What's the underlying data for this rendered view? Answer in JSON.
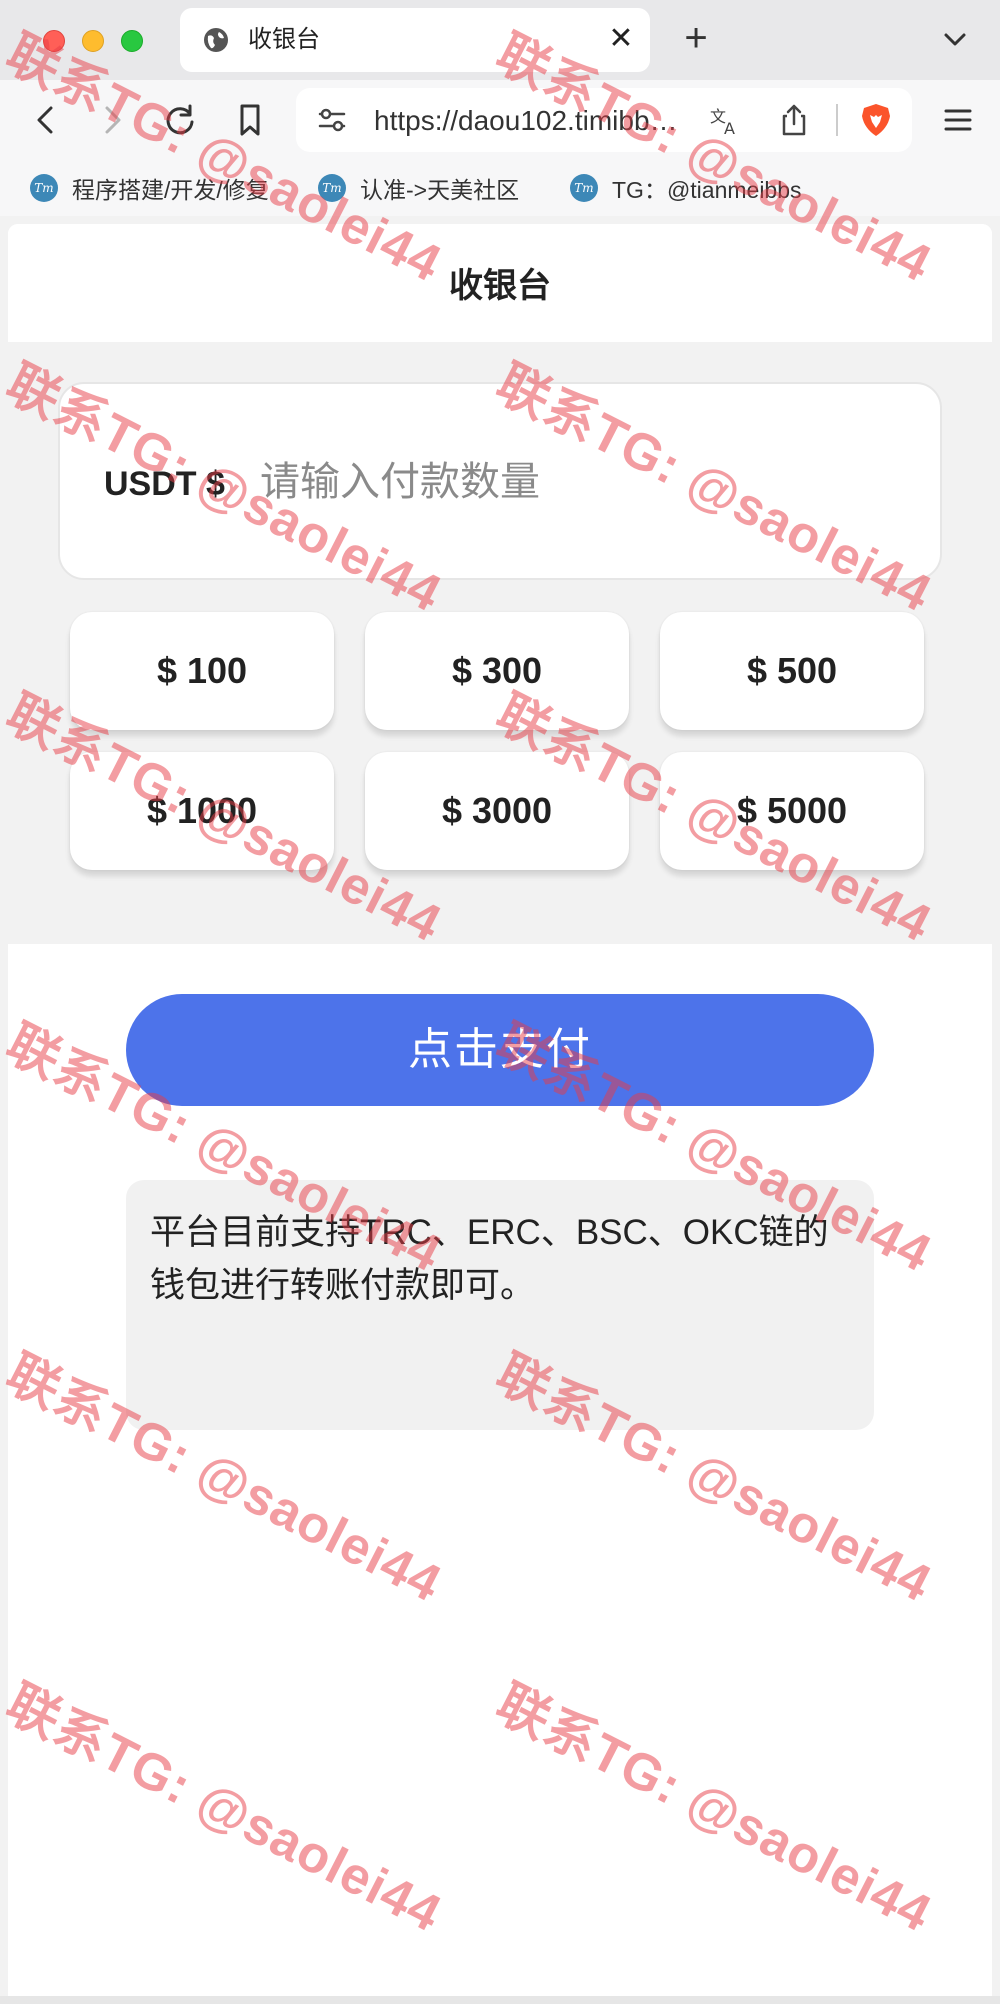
{
  "browser": {
    "tab_title": "收银台",
    "tab_close_glyph": "✕",
    "new_tab_glyph": "+",
    "url": "https://daou102.timibbs.com",
    "bookmarks": [
      {
        "label": "程序搭建/开发/修复",
        "icon": "tm-logo-icon"
      },
      {
        "label": "认准->天美社区",
        "icon": "tm-logo-icon"
      },
      {
        "label": "TG：@tianmeibbs",
        "icon": "tm-logo-icon"
      }
    ],
    "bookmark_logo_text": "Tm",
    "colors": {
      "tabbar": "#e8e8ea",
      "toolbar": "#f7f7f8",
      "brave_orange": "#fb542b"
    }
  },
  "page": {
    "title": "收银台",
    "currency_label": "USDT $",
    "amount_placeholder": "请输入付款数量",
    "presets": [
      "$ 100",
      "$ 300",
      "$ 500",
      "$ 1000",
      "$ 3000",
      "$ 5000"
    ],
    "pay_button_label": "点击支付",
    "notice": "平台目前支持TRC、ERC、BSC、OKC链的钱包进行转账付款即可。",
    "colors": {
      "accent": "#4d73ea",
      "section_bg": "#f2f2f2",
      "notice_bg": "#f1f1f1"
    }
  },
  "watermark": {
    "text": "联系TG: @saolei44",
    "color": "#e83c46"
  }
}
